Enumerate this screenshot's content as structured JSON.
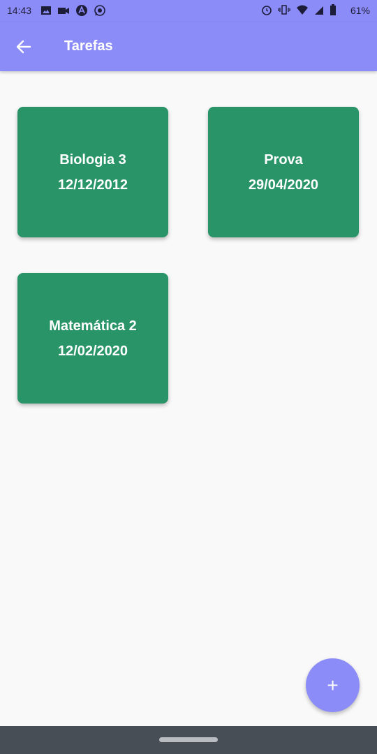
{
  "status_bar": {
    "time": "14:43",
    "battery_text": "61%",
    "left_icons": [
      "image-icon",
      "video-icon",
      "app-icon",
      "whatsapp-icon"
    ],
    "right_icons": [
      "alarm-icon",
      "vibrate-icon",
      "wifi-icon",
      "signal-icon",
      "battery-icon"
    ]
  },
  "app_bar": {
    "title": "Tarefas",
    "back_icon": "arrow-back-icon"
  },
  "tasks": [
    {
      "name": "Biologia 3",
      "date": "12/12/2012"
    },
    {
      "name": "Prova",
      "date": "29/04/2020"
    },
    {
      "name": "Matemática 2",
      "date": "12/02/2020"
    }
  ],
  "fab": {
    "label": "+"
  },
  "colors": {
    "app_bar": "#8c8cf8",
    "card": "#289467",
    "background": "#f9f9f9",
    "nav_bar": "#474e56"
  }
}
